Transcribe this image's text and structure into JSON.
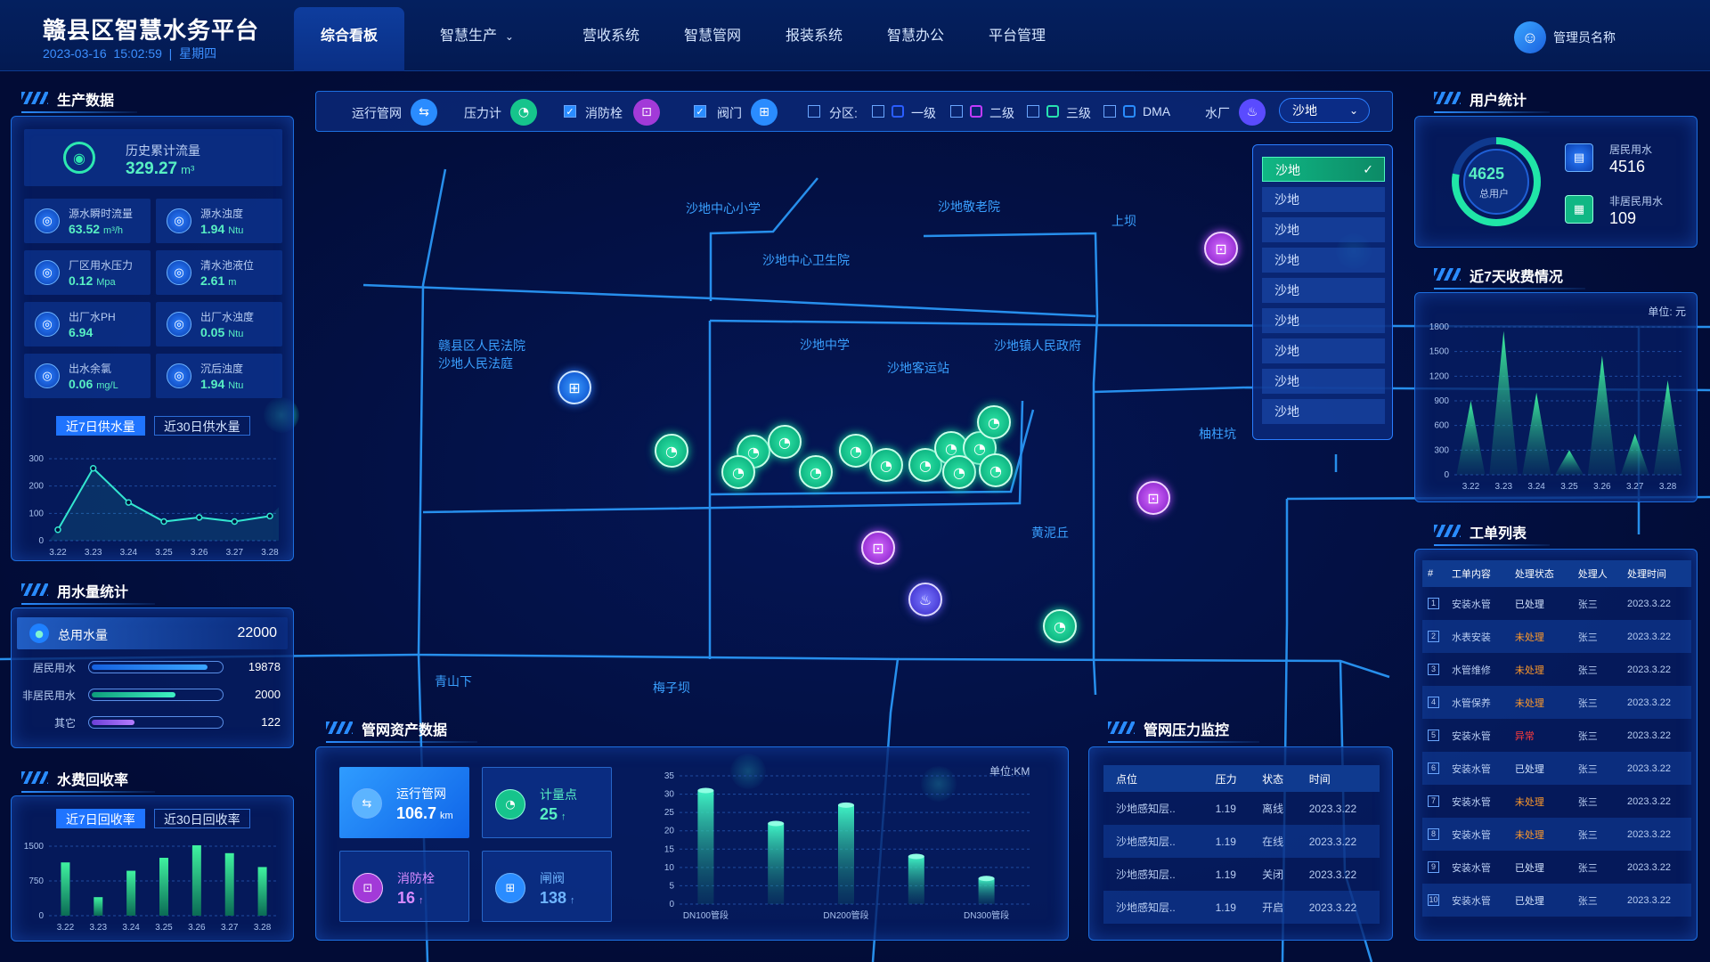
{
  "header": {
    "title": "赣县区智慧水务平台",
    "date": "2023-03-16",
    "time": "15:02:59",
    "weekday": "星期四",
    "nav": [
      "综合看板",
      "智慧生产",
      "营收系统",
      "智慧管网",
      "报装系统",
      "智慧办公",
      "平台管理"
    ],
    "user": "管理员名称"
  },
  "toolbar": {
    "run_pipe": "运行管网",
    "pressure": "压力计",
    "hydrant": "消防栓",
    "valve": "阀门",
    "zone": "分区:",
    "level1": "一级",
    "level2": "二级",
    "level3": "三级",
    "dma": "DMA",
    "plant": "水厂",
    "selected": "沙地",
    "options": [
      "沙地",
      "沙地",
      "沙地",
      "沙地",
      "沙地",
      "沙地",
      "沙地",
      "沙地",
      "沙地"
    ]
  },
  "map_labels": [
    "沙地中心小学",
    "沙地敬老院",
    "上坝",
    "沙地中心卫生院",
    "赣县区人民法院",
    "沙地人民法庭",
    "沙地中学",
    "沙地镇人民政府",
    "沙地客运站",
    "柚柱坑",
    "黄泥丘",
    "青山下",
    "梅子坝"
  ],
  "production": {
    "title": "生产数据",
    "total_label": "历史累计流量",
    "total_value": "329.27",
    "total_unit": "m³",
    "items": [
      {
        "label": "源水瞬时流量",
        "value": "63.52",
        "unit": "m³/h",
        "icon": "flow-icon"
      },
      {
        "label": "源水浊度",
        "value": "1.94",
        "unit": "Ntu",
        "icon": "turbidity-icon"
      },
      {
        "label": "厂区用水压力",
        "value": "0.12",
        "unit": "Mpa",
        "icon": "gauge-icon"
      },
      {
        "label": "清水池液位",
        "value": "2.61",
        "unit": "m",
        "icon": "level-icon"
      },
      {
        "label": "出厂水PH",
        "value": "6.94",
        "unit": "",
        "icon": "ph-icon"
      },
      {
        "label": "出厂水浊度",
        "value": "0.05",
        "unit": "Ntu",
        "icon": "turbidity-icon"
      },
      {
        "label": "出水余氯",
        "value": "0.06",
        "unit": "mg/L",
        "icon": "chlorine-icon"
      },
      {
        "label": "沉后浊度",
        "value": "1.94",
        "unit": "Ntu",
        "icon": "sediment-icon"
      }
    ],
    "tab1": "近7日供水量",
    "tab2": "近30日供水量"
  },
  "usage": {
    "title": "用水量统计",
    "total_label": "总用水量",
    "total_value": "22000",
    "rows": [
      {
        "label": "居民用水",
        "value": "19878",
        "pct": 0.9
      },
      {
        "label": "非居民用水",
        "value": "2000",
        "pct": 0.65
      },
      {
        "label": "其它",
        "value": "122",
        "pct": 0.33
      }
    ]
  },
  "recovery": {
    "title": "水费回收率",
    "tab1": "近7日回收率",
    "tab2": "近30日回收率"
  },
  "assets": {
    "title": "管网资产数据",
    "unit_label": "单位:KM",
    "cards": [
      {
        "label": "运行管网",
        "value": "106.7",
        "unit": "km"
      },
      {
        "label": "计量点",
        "value": "25",
        "unit": "↑"
      },
      {
        "label": "消防栓",
        "value": "16",
        "unit": "↑"
      },
      {
        "label": "闸阀",
        "value": "138",
        "unit": "↑"
      }
    ]
  },
  "pressure_monitor": {
    "title": "管网压力监控",
    "headers": [
      "点位",
      "压力",
      "状态",
      "时间"
    ],
    "rows": [
      [
        "沙地感知层..",
        "1.19",
        "离线",
        "2023.3.22"
      ],
      [
        "沙地感知层..",
        "1.19",
        "在线",
        "2023.3.22"
      ],
      [
        "沙地感知层..",
        "1.19",
        "关闭",
        "2023.3.22"
      ],
      [
        "沙地感知层..",
        "1.19",
        "开启",
        "2023.3.22"
      ]
    ]
  },
  "users": {
    "title": "用户统计",
    "total": "4625",
    "total_label": "总用户",
    "resident_label": "居民用水",
    "resident_value": "4516",
    "nonresident_label": "非居民用水",
    "nonresident_value": "109"
  },
  "fees": {
    "title": "近7天收费情况",
    "unit_label": "单位: 元"
  },
  "workorders": {
    "title": "工单列表",
    "headers": [
      "#",
      "工单内容",
      "处理状态",
      "处理人",
      "处理时间"
    ],
    "rows": [
      [
        "1",
        "安装水管",
        "已处理",
        "张三",
        "2023.3.22"
      ],
      [
        "2",
        "水表安装",
        "未处理",
        "张三",
        "2023.3.22"
      ],
      [
        "3",
        "水管维修",
        "未处理",
        "张三",
        "2023.3.22"
      ],
      [
        "4",
        "水管保养",
        "未处理",
        "张三",
        "2023.3.22"
      ],
      [
        "5",
        "安装水管",
        "异常",
        "张三",
        "2023.3.22"
      ],
      [
        "6",
        "安装水管",
        "已处理",
        "张三",
        "2023.3.22"
      ],
      [
        "7",
        "安装水管",
        "未处理",
        "张三",
        "2023.3.22"
      ],
      [
        "8",
        "安装水管",
        "未处理",
        "张三",
        "2023.3.22"
      ],
      [
        "9",
        "安装水管",
        "已处理",
        "张三",
        "2023.3.22"
      ],
      [
        "10",
        "安装水管",
        "已处理",
        "张三",
        "2023.3.22"
      ]
    ]
  },
  "colors": {
    "done": "#d6e6ff",
    "todo": "#ff9a2a",
    "error": "#ff3b3b",
    "accent": "#58f0c3",
    "primary": "#1f74ff"
  },
  "chart_data": [
    {
      "type": "line",
      "name": "supply-7d",
      "categories": [
        "3.22",
        "3.23",
        "3.24",
        "3.25",
        "3.26",
        "3.27",
        "3.28"
      ],
      "values": [
        40,
        265,
        140,
        70,
        85,
        70,
        90
      ],
      "ylim": [
        0,
        300
      ],
      "yticks": [
        0,
        100,
        200,
        300
      ]
    },
    {
      "type": "bar",
      "name": "recovery-7d",
      "categories": [
        "3.22",
        "3.23",
        "3.24",
        "3.25",
        "3.26",
        "3.27",
        "3.28"
      ],
      "values": [
        1150,
        400,
        970,
        1250,
        1520,
        1350,
        1050
      ],
      "ylim": [
        0,
        1500
      ],
      "yticks": [
        0,
        750,
        1500
      ]
    },
    {
      "type": "bar",
      "name": "asset-pipes",
      "categories": [
        "DN100管段",
        "",
        "DN200管段",
        "",
        "DN300管段"
      ],
      "values": [
        31,
        22,
        27,
        13,
        7
      ],
      "ylim": [
        0,
        35
      ],
      "yticks": [
        0,
        5,
        10,
        15,
        20,
        25,
        30,
        35
      ]
    },
    {
      "type": "area",
      "name": "fees-7d",
      "categories": [
        "3.22",
        "3.23",
        "3.24",
        "3.25",
        "3.26",
        "3.27",
        "3.28"
      ],
      "values": [
        900,
        1750,
        1000,
        300,
        1450,
        500,
        1150
      ],
      "ylim": [
        0,
        1800
      ],
      "yticks": [
        0,
        300,
        600,
        900,
        1200,
        1500,
        1800
      ]
    }
  ]
}
